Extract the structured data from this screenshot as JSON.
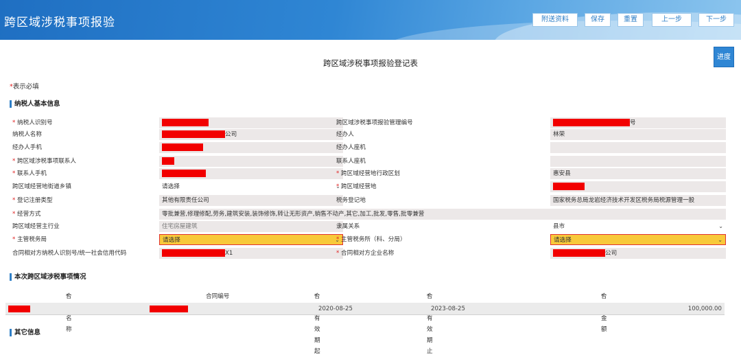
{
  "header": {
    "app_title": "跨区域涉税事项报验",
    "buttons": [
      {
        "label": "附送资料"
      },
      {
        "label": "保存"
      },
      {
        "label": "重置"
      },
      {
        "label": "上一步"
      },
      {
        "label": "下一步"
      }
    ]
  },
  "progress_label": "进度",
  "form_title": "跨区域涉税事项报验登记表",
  "required_note": {
    "star": "*",
    "text": "表示必填"
  },
  "section_basic": "纳税人基本信息",
  "basic_rows": [
    {
      "l1": "纳税人识别号",
      "r1": true,
      "v1": "",
      "l2": "跨区域涉税事项报验管理编号",
      "r2": false,
      "v2": "号"
    },
    {
      "l1": "纳税人名称",
      "r1": false,
      "v1": "公司",
      "l2": "经办人",
      "r2": false,
      "v2": "林荣"
    },
    {
      "l1": "经办人手机",
      "r1": false,
      "v1": "",
      "l2": "经办人座机",
      "r2": false,
      "v2": ""
    },
    {
      "l1": "跨区域涉税事项联系人",
      "r1": true,
      "v1": "",
      "l2": "联系人座机",
      "r2": false,
      "v2": ""
    },
    {
      "l1": "联系人手机",
      "r1": true,
      "v1": "",
      "l2": "跨区域经营地行政区划",
      "r2": true,
      "v2": "惠安县"
    },
    {
      "l1": "跨区域经营地街道乡镇",
      "r1": false,
      "v1": "请选择",
      "l2": "跨区域经营地",
      "r2": true,
      "v2": ""
    },
    {
      "l1": "登记注册类型",
      "r1": true,
      "v1": "其他有限责任公司",
      "l2": "税务登记地",
      "r2": false,
      "v2": "国家税务总局龙岩经济技术开发区税务局税源管理一股"
    },
    {
      "l1": "经营方式",
      "r1": true,
      "v1": "零批兼营,修理修配,劳务,建筑安装,装饰修饰,转让无形资产,销售不动产,其它,加工,批发,零售,批零兼营"
    },
    {
      "l1": "跨区域经营主行业",
      "r1": false,
      "v1": "住宅房屋建筑",
      "l2": "隶属关系",
      "r2": false,
      "v2": "县市"
    },
    {
      "l1": "主管税务局",
      "r1": true,
      "v1": "请选择",
      "l2": "主管税务所（科、分局）",
      "r2": true,
      "v2": "请选择"
    },
    {
      "l1": "合同相对方纳税人识别号/统一社会信用代码",
      "r1": false,
      "v1": "X1",
      "l2": "合同相对方企业名称",
      "r2": true,
      "v2": "公司"
    }
  ],
  "section_contract": "本次跨区域涉税事项情况",
  "contract_table": {
    "headers": [
      {
        "label": "合同名称",
        "req": true
      },
      {
        "label": "合同编号",
        "req": false
      },
      {
        "label": "合同有效期起",
        "req": true
      },
      {
        "label": "合同有效期止",
        "req": true
      },
      {
        "label": "合同金额",
        "req": true
      }
    ],
    "row": {
      "start": "2020-08-25",
      "end": "2023-08-25",
      "amount": "100,000.00"
    }
  },
  "section_other": "其它信息",
  "colors": {
    "accent": "#2f86d4",
    "required": "#e02020",
    "redaction": "#f20000",
    "highlight": "#f8c93a"
  }
}
